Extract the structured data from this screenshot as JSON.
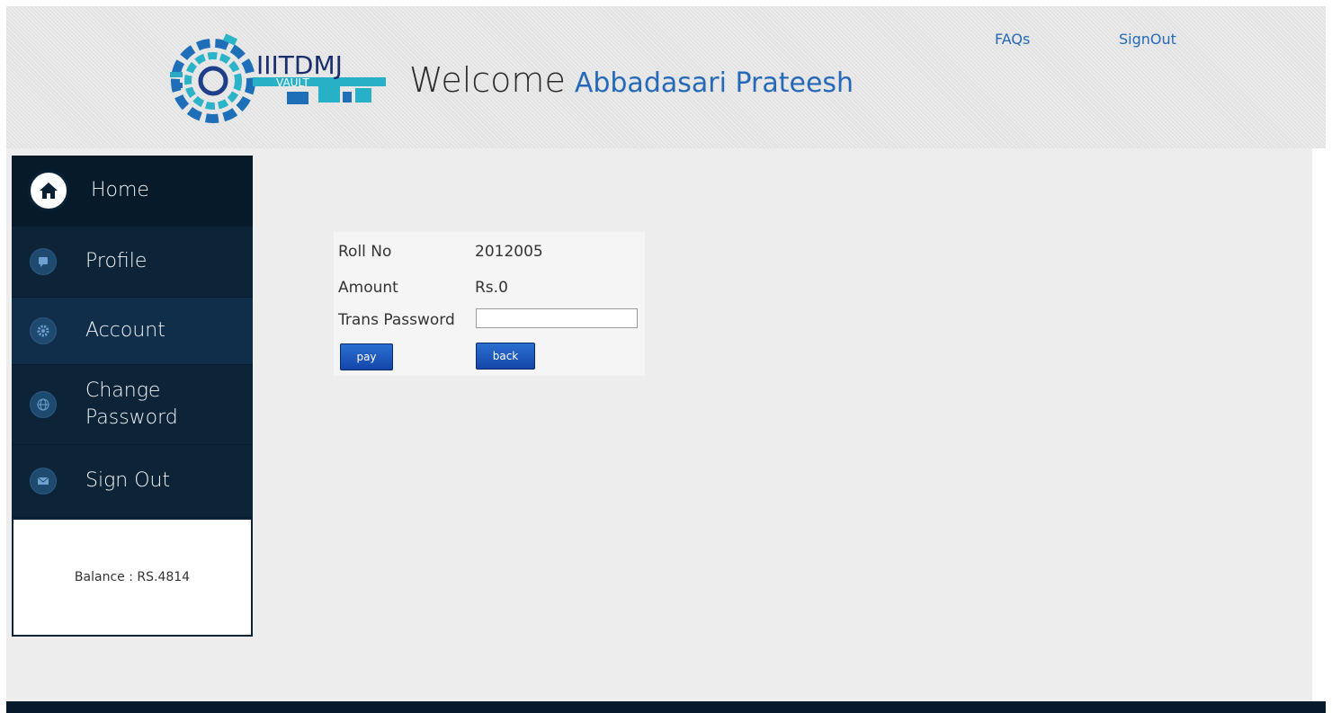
{
  "header": {
    "logo_text": "IIITDMJ",
    "logo_subtext": "VAULT",
    "welcome_label": "Welcome",
    "user_name": "Abbadasari Prateesh",
    "links": [
      {
        "label": "FAQs"
      },
      {
        "label": "SignOut"
      }
    ]
  },
  "sidebar": {
    "items": [
      {
        "label": "Home",
        "icon": "home-icon"
      },
      {
        "label": "Profile",
        "icon": "profile-icon"
      },
      {
        "label": "Account",
        "icon": "gear-icon"
      },
      {
        "label": "Change Password",
        "icon": "globe-icon"
      },
      {
        "label": "Sign Out",
        "icon": "mail-icon"
      }
    ],
    "balance": "Balance : RS.4814"
  },
  "payment": {
    "roll_label": "Roll No",
    "roll_value": "2012005",
    "amount_label": "Amount",
    "amount_value": "Rs.0",
    "password_label": "Trans Password",
    "password_value": "",
    "pay_label": "pay",
    "back_label": "back"
  },
  "colors": {
    "accent": "#2569b8",
    "sidebar_bg": "#0d2438",
    "button": "#1a56bf"
  }
}
